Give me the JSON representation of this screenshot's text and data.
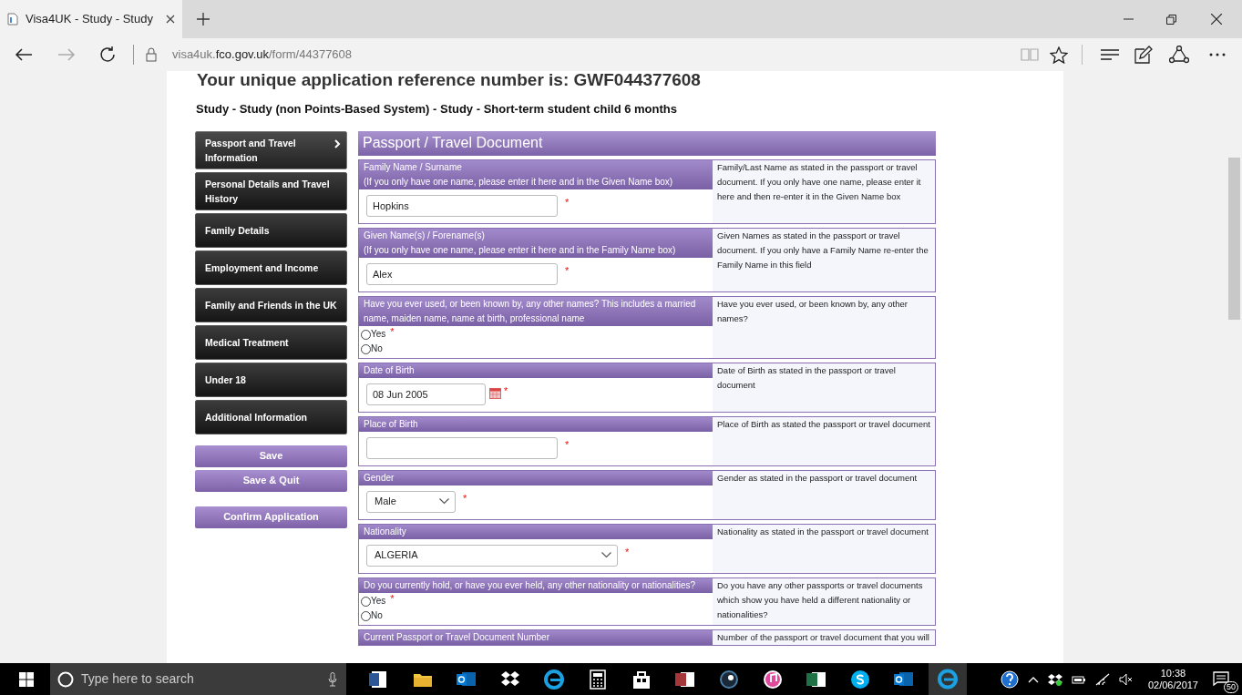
{
  "browser": {
    "tab_title": "Visa4UK - Study - Study",
    "url": {
      "prefix": "visa4uk.",
      "domain": "fco.gov.uk",
      "path": "/form/44377608"
    }
  },
  "page": {
    "reference_heading": "Your unique application reference number is: GWF044377608",
    "subtitle": "Study - Study (non Points-Based System) - Study - Short-term student child 6 months",
    "sidebar": [
      {
        "label": "Passport and Travel Information",
        "selected": true
      },
      {
        "label": "Personal Details and Travel History",
        "selected": false
      },
      {
        "label": "Family Details",
        "selected": false
      },
      {
        "label": "Employment and Income",
        "selected": false
      },
      {
        "label": "Family and Friends in the UK",
        "selected": false
      },
      {
        "label": "Medical Treatment",
        "selected": false
      },
      {
        "label": "Under 18",
        "selected": false
      },
      {
        "label": "Additional Information",
        "selected": false
      }
    ],
    "buttons": [
      {
        "label": "Save"
      },
      {
        "label": "Save & Quit"
      },
      {
        "label": "Confirm Application"
      }
    ],
    "section_title": "Passport / Travel Document",
    "fields": [
      {
        "kind": "text",
        "label": "Family Name / Surname",
        "hint": "(If you only have one name, please enter it here and in the Given Name box)",
        "value": "Hopkins",
        "required_mark": "*",
        "help": "Family/Last Name as stated in the passport or travel document. If you only have one name, please enter it here and then re-enter it in the Given Name box"
      },
      {
        "kind": "text",
        "label": "Given Name(s) / Forename(s)",
        "hint": "(If you only have one name, please enter it here and in the Family Name box)",
        "value": "Alex",
        "required_mark": "*",
        "help": "Given Names as stated in the passport or travel document. If you only have a Family Name re-enter the Family Name in this field"
      },
      {
        "kind": "radio",
        "label": "Have you ever used, or been known by, any other names? This includes a married name, maiden name, name at birth, professional name",
        "required_mark": "*",
        "options": [
          {
            "label": "Yes",
            "selected": false
          },
          {
            "label": "No",
            "selected": false
          }
        ],
        "help": "Have you ever used, or been known by, any other names?"
      },
      {
        "kind": "date",
        "label": "Date of Birth",
        "value": "08 Jun 2005",
        "required_mark": "*",
        "help": "Date of Birth as stated in the passport or travel document"
      },
      {
        "kind": "text",
        "label": "Place of Birth",
        "required_mark": "*",
        "help": "Place of Birth as stated the passport or travel document"
      },
      {
        "kind": "select",
        "label": "Gender",
        "value": "Male",
        "required_mark": "*",
        "help": "Gender as stated in the passport or travel document"
      },
      {
        "kind": "select",
        "label": "Nationality",
        "value": "ALGERIA",
        "required_mark": "*",
        "help": "Nationality as stated in the passport or travel document"
      },
      {
        "kind": "radio",
        "label": "Do you currently hold, or have you ever held, any other nationality or nationalities?",
        "required_mark": "*",
        "options": [
          {
            "label": "Yes",
            "selected": false
          },
          {
            "label": "No",
            "selected": false
          }
        ],
        "help": "Do you have any other passports or travel documents which show you have held a different nationality or nationalities?"
      },
      {
        "kind": "heading",
        "label": "Current Passport or Travel Document Number",
        "help": "Number of the passport or travel document that you will"
      }
    ]
  },
  "taskbar": {
    "search_placeholder": "Type here to search",
    "time": "10:38",
    "date": "02/06/2017",
    "notification_count": "50"
  }
}
